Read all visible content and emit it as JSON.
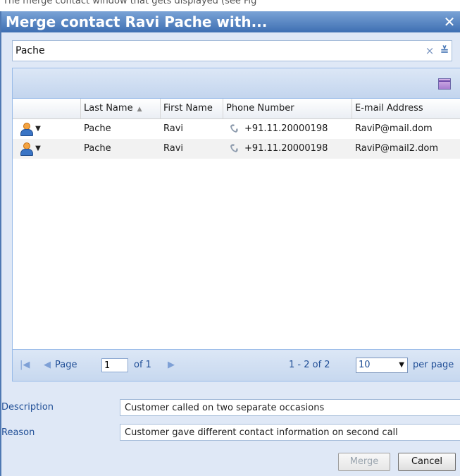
{
  "top_fragment": "The merge contact window that gets displayed (see Fig",
  "dialog": {
    "title": "Merge contact Ravi Pache with...",
    "close_glyph": "✕"
  },
  "search": {
    "value": "Pache",
    "clear_glyph": "×",
    "expand_glyph": "≚"
  },
  "grid": {
    "columns": [
      {
        "label": "",
        "sorted": false
      },
      {
        "label": "Last Name",
        "sorted": true,
        "sort_dir": "asc"
      },
      {
        "label": "First Name",
        "sorted": false
      },
      {
        "label": "Phone Number",
        "sorted": false
      },
      {
        "label": "E-mail Address",
        "sorted": false
      }
    ],
    "rows": [
      {
        "last_name": "Pache",
        "first_name": "Ravi",
        "phone": "+91.11.20000198",
        "email": "RaviP@mail.dom"
      },
      {
        "last_name": "Pache",
        "first_name": "Ravi",
        "phone": "+91.11.20000198",
        "email": "RaviP@mail2.dom"
      }
    ],
    "row_menu_glyph": "▼",
    "sort_glyph": "▲"
  },
  "pager": {
    "first_glyph": "|◀",
    "prev_glyph": "◀",
    "page_label": "Page",
    "page_value": "1",
    "of_label": "of 1",
    "next_glyph": "▶",
    "range_text": "1 - 2 of 2",
    "page_size": "10",
    "page_size_glyph": "▼",
    "per_page_label": "per page"
  },
  "form": {
    "description_label": "Description",
    "description_value": "Customer called on two separate occasions",
    "reason_label": "Reason",
    "reason_value": "Customer gave different contact information on second call"
  },
  "buttons": {
    "merge_label": "Merge",
    "cancel_label": "Cancel"
  },
  "colors": {
    "title_bar": "#3e6fb2",
    "panel_bg": "#dfe8f6",
    "label_text": "#1f4e96"
  },
  "icons": [
    "close-icon",
    "clear-icon",
    "expand-icon",
    "columns-icon",
    "person-icon",
    "phone-icon",
    "first-page-icon",
    "prev-page-icon",
    "next-page-icon",
    "dropdown-arrow-icon"
  ]
}
